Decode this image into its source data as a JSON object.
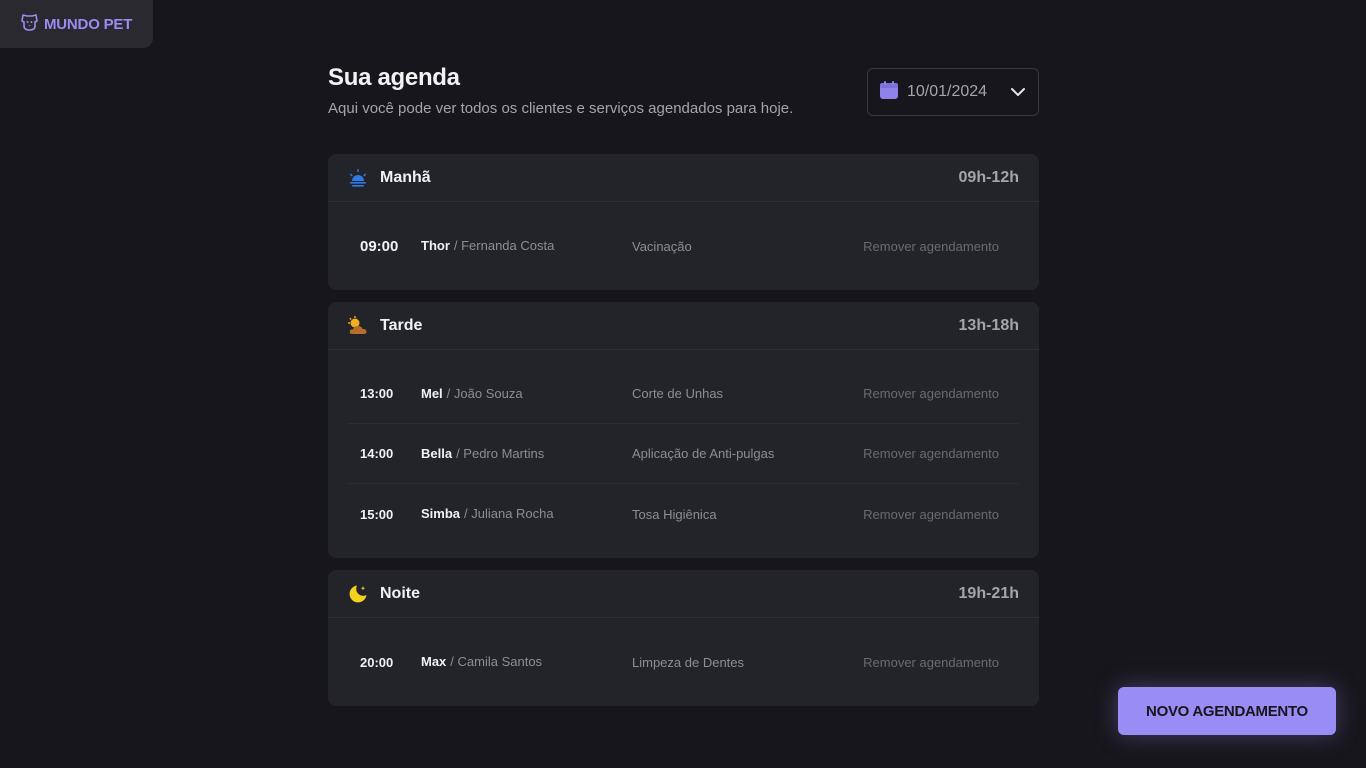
{
  "brand": {
    "name": "MUNDO PET",
    "accent": "#9a8cf0"
  },
  "header": {
    "title": "Sua agenda",
    "subtitle": "Aqui você pode ver todos os clientes e serviços agendados para hoje.",
    "date": "10/01/2024"
  },
  "periods": [
    {
      "name": "Manhã",
      "range": "09h-12h",
      "icon": "sunrise-icon",
      "appointments": [
        {
          "time": "09:00",
          "pet": "Thor",
          "owner": "/ Fernanda Costa",
          "service": "Vacinação",
          "action": "Remover agendamento"
        }
      ]
    },
    {
      "name": "Tarde",
      "range": "13h-18h",
      "icon": "cloud-sun-icon",
      "appointments": [
        {
          "time": "13:00",
          "pet": "Mel",
          "owner": "/ João Souza",
          "service": "Corte de Unhas",
          "action": "Remover agendamento"
        },
        {
          "time": "14:00",
          "pet": "Bella",
          "owner": "/ Pedro Martins",
          "service": "Aplicação de Anti-pulgas",
          "action": "Remover agendamento"
        },
        {
          "time": "15:00",
          "pet": "Simba",
          "owner": "/ Juliana Rocha",
          "service": "Tosa Higiênica",
          "action": "Remover agendamento"
        }
      ]
    },
    {
      "name": "Noite",
      "range": "19h-21h",
      "icon": "moon-icon",
      "appointments": [
        {
          "time": "20:00",
          "pet": "Max",
          "owner": "/ Camila Santos",
          "service": "Limpeza de Dentes",
          "action": "Remover agendamento"
        }
      ]
    }
  ],
  "new_button": "NOVO AGENDAMENTO"
}
